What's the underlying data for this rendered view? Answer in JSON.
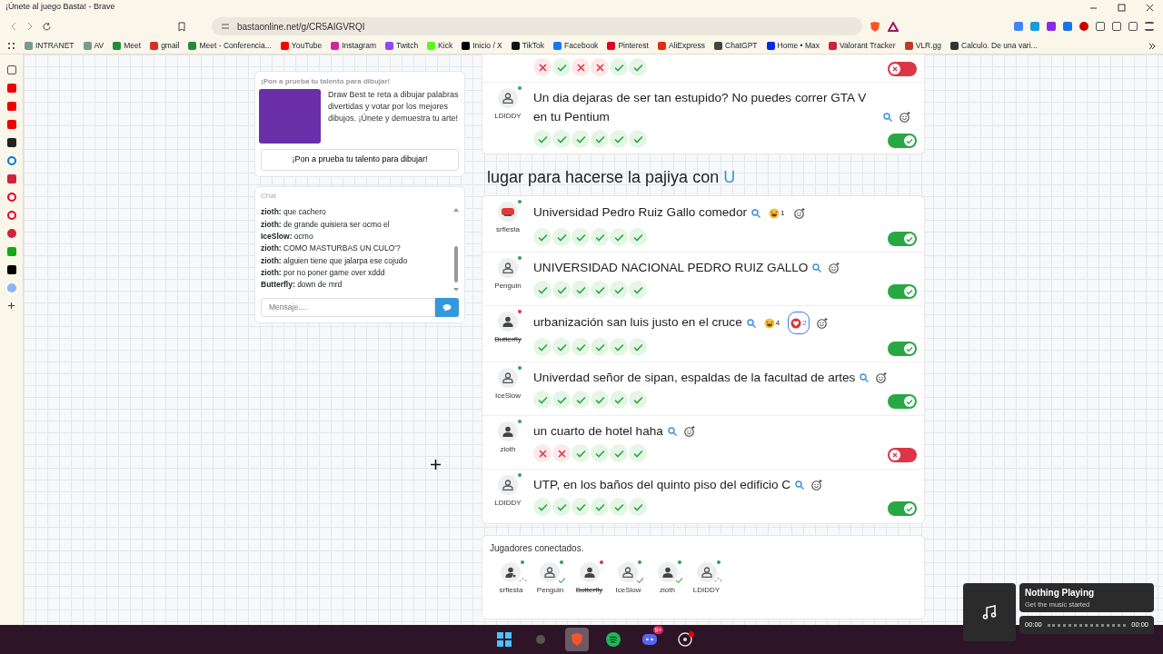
{
  "window": {
    "title": "¡Únete al juego Basta! - Brave"
  },
  "browser": {
    "url": "bastaonline.net/g/CR5AIGVRQI",
    "bookmarks": [
      {
        "label": "INTRANET",
        "color": "#7a9a8a"
      },
      {
        "label": "AV",
        "color": "#7a9a8a"
      },
      {
        "label": "Meet",
        "color": "#1e8e3e"
      },
      {
        "label": "gmail",
        "color": "#d93025"
      },
      {
        "label": "Meet - Conferencia...",
        "color": "#1e8e3e"
      },
      {
        "label": "YouTube",
        "color": "#ff0000"
      },
      {
        "label": "Instagram",
        "color": "#d6249f"
      },
      {
        "label": "Twitch",
        "color": "#9146ff"
      },
      {
        "label": "Kick",
        "color": "#53fc18"
      },
      {
        "label": "Inicio / X",
        "color": "#000000"
      },
      {
        "label": "TikTok",
        "color": "#111111"
      },
      {
        "label": "Facebook",
        "color": "#1877f2"
      },
      {
        "label": "Pinterest",
        "color": "#e60023"
      },
      {
        "label": "AliExpress",
        "color": "#e62e04"
      },
      {
        "label": "ChatGPT",
        "color": "#444444"
      },
      {
        "label": "Home • Max",
        "color": "#002be7"
      },
      {
        "label": "Valorant Tracker",
        "color": "#d0223a"
      },
      {
        "label": "VLR.gg",
        "color": "#c0392b"
      },
      {
        "label": "Calculo. De una vari...",
        "color": "#333333"
      }
    ]
  },
  "promo": {
    "title": "¡Pon a prueba tu talento para dibujar!",
    "description": "Draw Best te reta a dibujar palabras divertidas y votar por los mejores dibujos. ¡Únete y demuestra tu arte!",
    "button": "¡Pon a prueba tu talento para dibujar!"
  },
  "chat": {
    "title": "Chat",
    "messages": [
      {
        "user": "zioth:",
        "text": "que cachero"
      },
      {
        "user": "zioth:",
        "text": "de grande quisiera ser ocmo el"
      },
      {
        "user": "IceSlow:",
        "text": "ocmo"
      },
      {
        "user": "zioth:",
        "text": "COMO MASTURBAS UN CULO'?"
      },
      {
        "user": "zioth:",
        "text": "alguien tiene que jalarpa ese cojudo"
      },
      {
        "user": "zioth:",
        "text": "por no poner game over xddd"
      },
      {
        "user": "Butterfly:",
        "text": "down de mrd"
      }
    ],
    "placeholder": "Mensaje...."
  },
  "previous_answers": [
    {
      "votes": [
        false,
        true,
        false,
        false,
        true,
        true
      ],
      "valid": false
    },
    {
      "player": "LDIDDY",
      "kind": "outline",
      "color": "#28a745",
      "struck": false,
      "text": "Un dia dejaras de ser tan estupido? No puedes correr GTA V en tu Pentium",
      "votes": [
        true,
        true,
        true,
        true,
        true,
        true
      ],
      "valid": true
    }
  ],
  "category": {
    "heading": "lugar para hacerse la pajiya con",
    "letter": "U"
  },
  "answers": [
    {
      "player": "srfiesta",
      "kind": "stop",
      "color": "#28a745",
      "struck": false,
      "text": "Universidad Pedro Ruiz Gallo comedor",
      "reactions": [
        {
          "kind": "laugh",
          "count": "1",
          "selected": false
        }
      ],
      "votes": [
        true,
        true,
        true,
        true,
        true,
        true
      ],
      "valid": true
    },
    {
      "player": "Penguin",
      "kind": "outline",
      "color": "#28a745",
      "struck": false,
      "text": "UNIVERSIDAD NACIONAL PEDRO RUIZ GALLO",
      "votes": [
        true,
        true,
        true,
        true,
        true,
        true
      ],
      "valid": true
    },
    {
      "player": "Butterfly",
      "kind": "filled",
      "color": "#dc3545",
      "struck": true,
      "text": "urbanización san luis justo en el cruce",
      "reactions": [
        {
          "kind": "laugh",
          "count": "4",
          "selected": false
        },
        {
          "kind": "heart",
          "count": "2",
          "selected": true
        }
      ],
      "votes": [
        true,
        true,
        true,
        true,
        true,
        true
      ],
      "valid": true
    },
    {
      "player": "IceSlow",
      "kind": "outline",
      "color": "#28a745",
      "struck": false,
      "text": "Univerdad señor de sipan, espaldas de la facultad de artes",
      "votes": [
        true,
        true,
        true,
        true,
        true,
        true
      ],
      "valid": true
    },
    {
      "player": "zioth",
      "kind": "filled",
      "color": "#28a745",
      "struck": false,
      "text": "un cuarto de hotel haha",
      "votes": [
        false,
        false,
        true,
        true,
        true,
        true
      ],
      "valid": false
    },
    {
      "player": "LDIDDY",
      "kind": "outline",
      "color": "#28a745",
      "struck": false,
      "text": "UTP, en los baños del quinto piso del edificio C",
      "votes": [
        true,
        true,
        true,
        true,
        true,
        true
      ],
      "valid": true
    }
  ],
  "players": {
    "title": "Jugadores conectados.",
    "list": [
      {
        "name": "srfiesta",
        "kind": "host",
        "color": "#28a745",
        "struck": false,
        "answered": false,
        "typing": true
      },
      {
        "name": "Penguin",
        "kind": "outline",
        "color": "#28a745",
        "struck": false,
        "answered": true,
        "typing": false
      },
      {
        "name": "Butterfly",
        "kind": "filled",
        "color": "#dc3545",
        "struck": true,
        "answered": false,
        "typing": false
      },
      {
        "name": "IceSlow",
        "kind": "outline",
        "color": "#28a745",
        "struck": false,
        "answered": true,
        "typing": false
      },
      {
        "name": "zioth",
        "kind": "filled",
        "color": "#28a745",
        "struck": false,
        "answered": true,
        "typing": false
      },
      {
        "name": "LDIDDY",
        "kind": "outline",
        "color": "#28a745",
        "struck": false,
        "answered": false,
        "typing": true
      }
    ]
  },
  "music": {
    "title": "Nothing Playing",
    "subtitle": "Get the music started",
    "elapsed": "00:00",
    "total": "00:00"
  },
  "taskbar": {
    "discord_badge": "9+"
  }
}
